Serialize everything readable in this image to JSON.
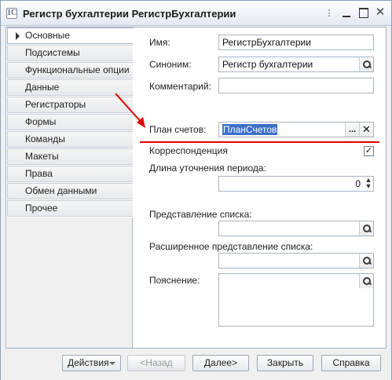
{
  "window": {
    "title": "Регистр бухгалтерии РегистрБухгалтерии",
    "icon_text": "1С"
  },
  "nav": {
    "items": [
      {
        "label": "Основные",
        "active": true
      },
      {
        "label": "Подсистемы"
      },
      {
        "label": "Функциональные опции"
      },
      {
        "label": "Данные"
      },
      {
        "label": "Регистраторы"
      },
      {
        "label": "Формы"
      },
      {
        "label": "Команды"
      },
      {
        "label": "Макеты"
      },
      {
        "label": "Права"
      },
      {
        "label": "Обмен данными"
      },
      {
        "label": "Прочее"
      }
    ]
  },
  "form": {
    "name_label": "Имя:",
    "name_value": "РегистрБухгалтерии",
    "synonym_label": "Синоним:",
    "synonym_value": "Регистр бухгалтерии",
    "comment_label": "Комментарий:",
    "comment_value": "",
    "chart_of_accounts_label": "План счетов:",
    "chart_of_accounts_value": "ПланСчетов",
    "correspondence_label": "Корреспонденция",
    "correspondence_checked": true,
    "period_label": "Длина уточнения периода:",
    "period_value": "0",
    "list_presentation_label": "Представление списка:",
    "list_presentation_value": "",
    "ext_list_presentation_label": "Расширенное представление списка:",
    "ext_list_presentation_value": "",
    "explanation_label": "Пояснение:",
    "explanation_value": ""
  },
  "buttons": {
    "actions": "Действия",
    "back": "<Назад",
    "next": "Далее>",
    "close": "Закрыть",
    "help": "Справка"
  },
  "icons": {
    "more": "more-glyph",
    "minimize": "minimize-icon",
    "maximize": "maximize-icon",
    "close": "close-icon",
    "search": "search-icon",
    "ellipsis": "ellipsis-icon",
    "clear": "clear-icon",
    "spinner": "spinner-icon"
  },
  "colors": {
    "annotation": "#e20000",
    "selection": "#3b6fc9"
  }
}
